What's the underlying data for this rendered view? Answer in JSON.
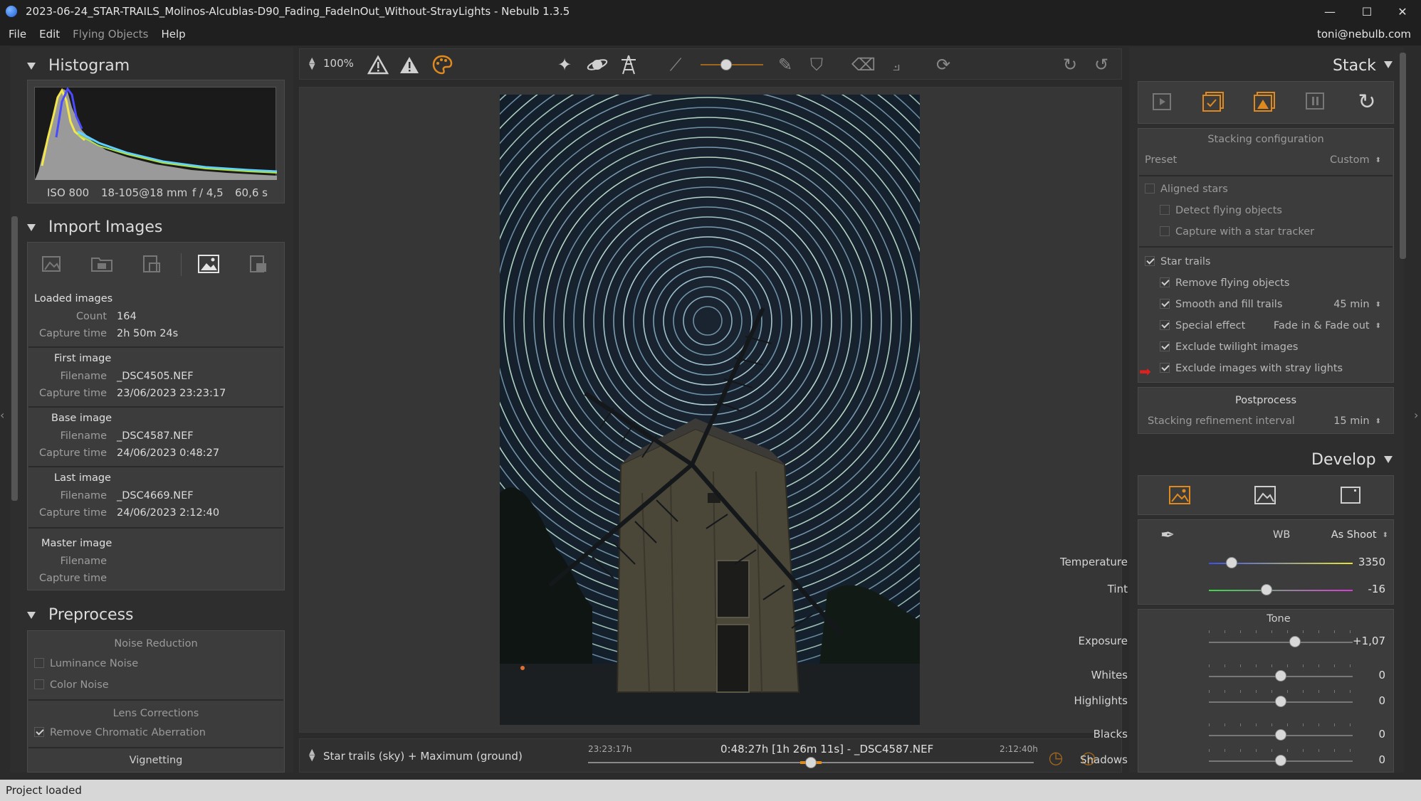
{
  "window": {
    "title": "2023-06-24_STAR-TRAILS_Molinos-Alcublas-D90_Fading_FadeInOut_Without-StrayLights - Nebulb 1.3.5",
    "controls": {
      "minimize": "—",
      "maximize": "☐",
      "close": "✕"
    }
  },
  "menu": {
    "file": "File",
    "edit": "Edit",
    "flying_objects": "Flying Objects",
    "help": "Help",
    "user": "toni@nebulb.com"
  },
  "histogram": {
    "title": "Histogram",
    "iso": "ISO 800",
    "lens": "18-105@18 mm",
    "aperture": "f / 4,5",
    "exposure": "60,6 s"
  },
  "import": {
    "title": "Import Images",
    "loaded_label": "Loaded images",
    "count_label": "Count",
    "count_value": "164",
    "capture_label": "Capture time",
    "capture_value": "2h 50m 24s",
    "first_label": "First image",
    "filename_label": "Filename",
    "first_filename": "_DSC4505.NEF",
    "first_capture": "23/06/2023 23:23:17",
    "base_label": "Base image",
    "base_filename": "_DSC4587.NEF",
    "base_capture": "24/06/2023 0:48:27",
    "last_label": "Last image",
    "last_filename": "_DSC4669.NEF",
    "last_capture": "24/06/2023 2:12:40",
    "master_label": "Master image",
    "master_filename": "",
    "master_capture": ""
  },
  "preprocess": {
    "title": "Preprocess",
    "noise_reduction": "Noise Reduction",
    "luminance_noise": "Luminance Noise",
    "color_noise": "Color Noise",
    "lens_corrections": "Lens Corrections",
    "remove_ca": "Remove Chromatic Aberration",
    "vignetting": "Vignetting"
  },
  "toolbar": {
    "zoom": "100%"
  },
  "bottombar": {
    "mode": "Star trails (sky) + Maximum (ground)",
    "start_time": "23:23:17h",
    "current": "0:48:27h [1h 26m 11s] - _DSC4587.NEF",
    "end_time": "2:12:40h",
    "timeline_position": 0.5
  },
  "stack": {
    "title": "Stack",
    "config_title": "Stacking configuration",
    "preset_label": "Preset",
    "preset_value": "Custom",
    "aligned_stars": "Aligned stars",
    "detect_flying": "Detect flying objects",
    "star_tracker": "Capture with a star tracker",
    "star_trails": "Star trails",
    "remove_flying": "Remove flying objects",
    "smooth_fill": "Smooth and fill trails",
    "smooth_value": "45 min",
    "special_effect": "Special effect",
    "special_value": "Fade in & Fade out",
    "exclude_twilight": "Exclude twilight images",
    "exclude_stray": "Exclude images with stray lights",
    "postprocess": "Postprocess",
    "refinement_label": "Stacking refinement interval",
    "refinement_value": "15 min"
  },
  "develop": {
    "title": "Develop",
    "wb_label": "WB",
    "wb_value": "As Shoot",
    "temperature_label": "Temperature",
    "temperature_value": "3350",
    "temperature_level": 0.16,
    "tint_label": "Tint",
    "tint_value": "-16",
    "tint_level": 0.4,
    "tone_label": "Tone",
    "exposure_label": "Exposure",
    "exposure_value": "+1,07",
    "exposure_level": 0.6,
    "whites_label": "Whites",
    "whites_value": "0",
    "highlights_label": "Highlights",
    "highlights_value": "0",
    "blacks_label": "Blacks",
    "blacks_value": "0",
    "shadows_label": "Shadows",
    "shadows_value": "0"
  },
  "status": {
    "text": "Project loaded"
  },
  "colors": {
    "accent": "#e08a1e",
    "arrow": "#e0201e"
  }
}
